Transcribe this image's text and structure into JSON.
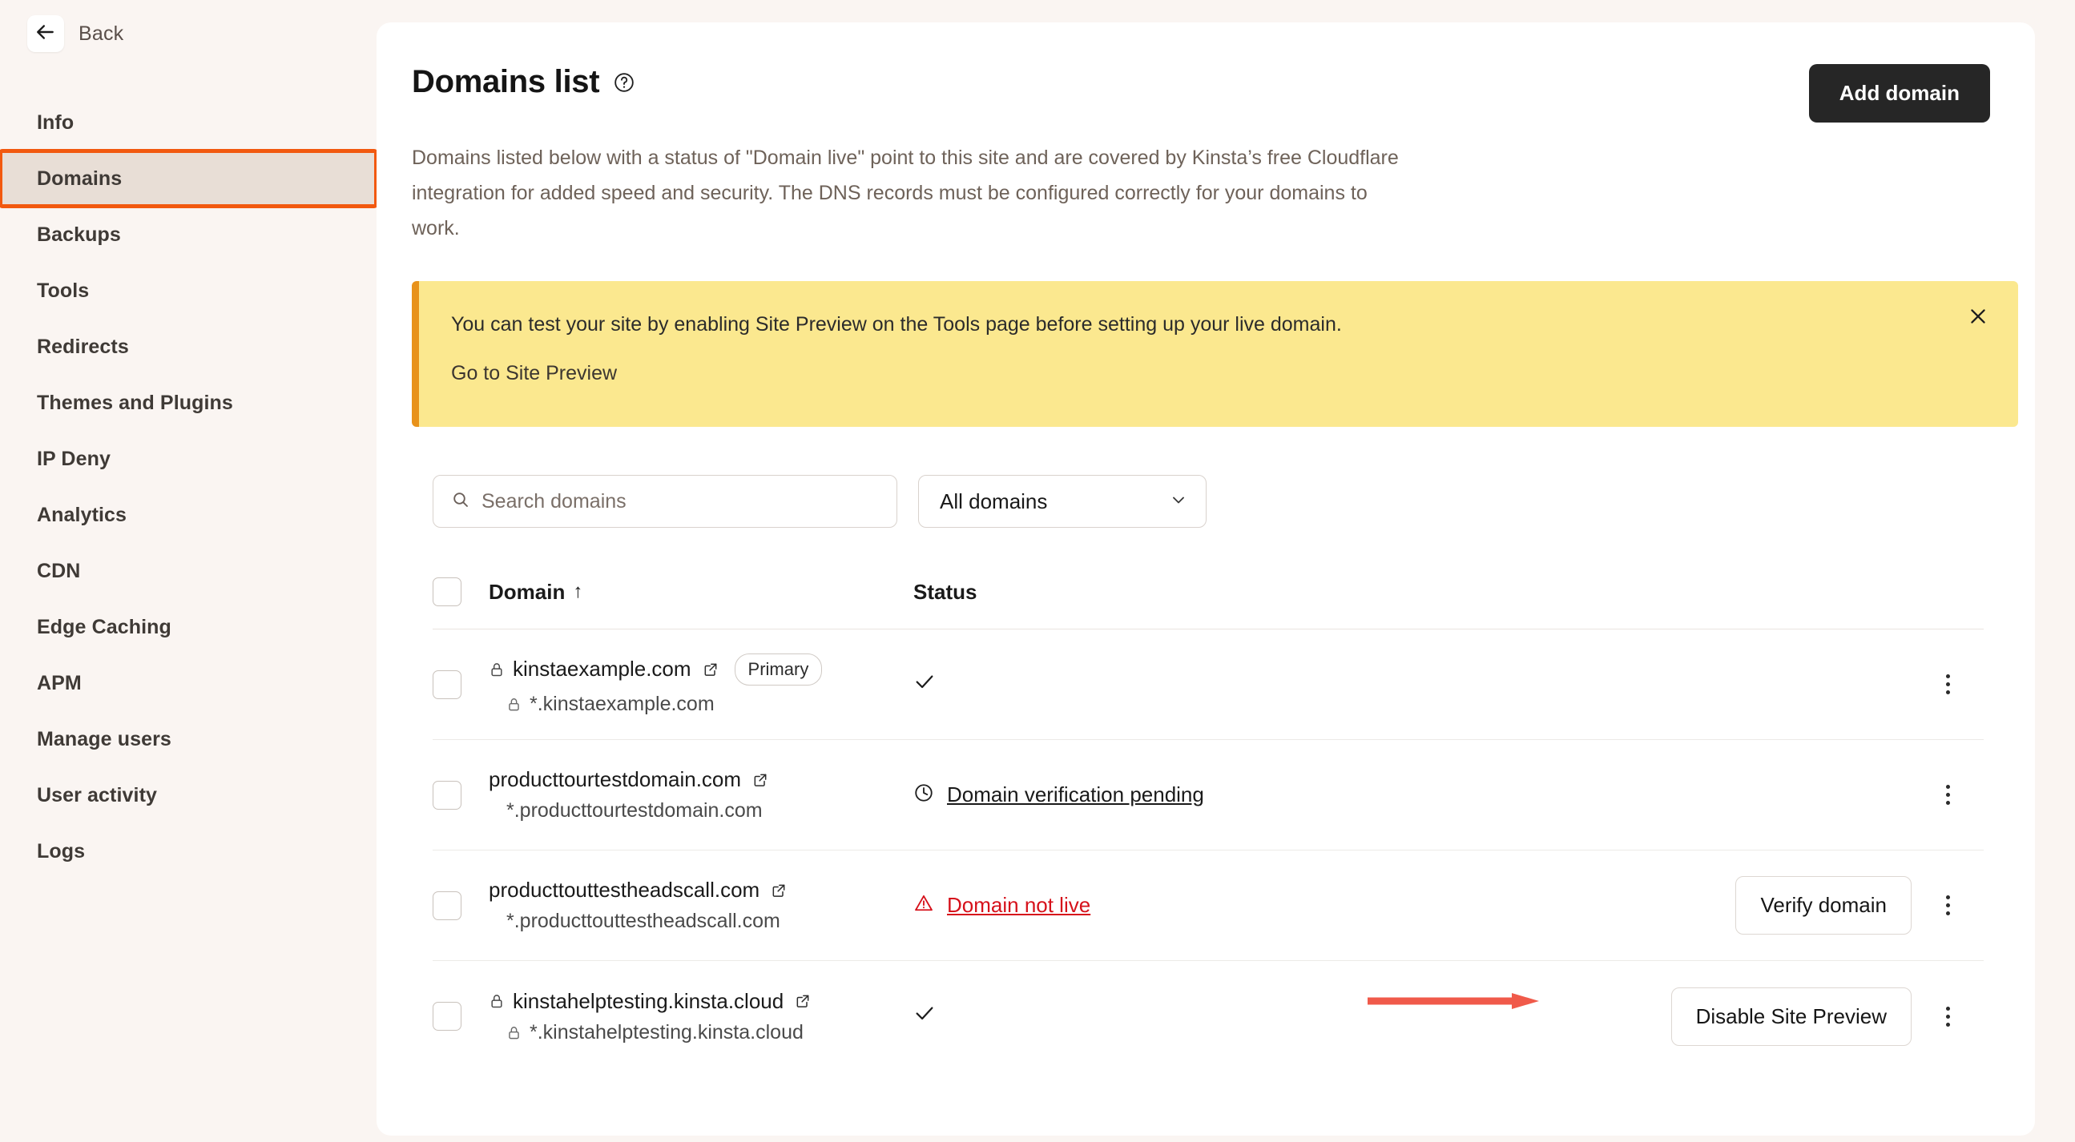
{
  "sidebar": {
    "back_label": "Back",
    "back_icon": "arrow-left-icon",
    "items": [
      {
        "label": "Info",
        "active": false
      },
      {
        "label": "Domains",
        "active": true
      },
      {
        "label": "Backups",
        "active": false
      },
      {
        "label": "Tools",
        "active": false
      },
      {
        "label": "Redirects",
        "active": false
      },
      {
        "label": "Themes and Plugins",
        "active": false
      },
      {
        "label": "IP Deny",
        "active": false
      },
      {
        "label": "Analytics",
        "active": false
      },
      {
        "label": "CDN",
        "active": false
      },
      {
        "label": "Edge Caching",
        "active": false
      },
      {
        "label": "APM",
        "active": false
      },
      {
        "label": "Manage users",
        "active": false
      },
      {
        "label": "User activity",
        "active": false
      },
      {
        "label": "Logs",
        "active": false
      }
    ]
  },
  "header": {
    "title": "Domains list",
    "help_icon": "question-circle-icon",
    "add_domain_label": "Add domain",
    "description": "Domains listed below with a status of \"Domain live\" point to this site and are covered by Kinsta’s free Cloudflare integration for added speed and security. The DNS records must be configured correctly for your domains to work."
  },
  "banner": {
    "message": "You can test your site by enabling Site Preview on the Tools page before setting up your live domain.",
    "link_label": "Go to Site Preview",
    "close_icon": "close-icon",
    "background": "#fbe88f",
    "accent": "#e8921a"
  },
  "filters": {
    "search_placeholder": "Search domains",
    "search_value": "",
    "search_icon": "search-icon",
    "select_value": "All domains",
    "select_icon": "chevron-down-icon"
  },
  "table": {
    "columns": {
      "domain": "Domain",
      "sort_indicator": "↑",
      "status": "Status"
    },
    "rows": [
      {
        "domain": "kinstaexample.com",
        "has_lock": true,
        "badge": "Primary",
        "wildcard": "*.kinstaexample.com",
        "wildcard_has_lock": true,
        "status_type": "live",
        "status_label": "",
        "status_icon": "check-icon",
        "action": "",
        "menu_icon": "kebab-menu-icon"
      },
      {
        "domain": "producttourtestdomain.com",
        "has_lock": false,
        "badge": "",
        "wildcard": "*.producttourtestdomain.com",
        "wildcard_has_lock": false,
        "status_type": "pending",
        "status_label": "Domain verification pending",
        "status_icon": "clock-icon",
        "action": "",
        "menu_icon": "kebab-menu-icon"
      },
      {
        "domain": "producttouttestheadscall.com",
        "has_lock": false,
        "badge": "",
        "wildcard": "*.producttouttestheadscall.com",
        "wildcard_has_lock": false,
        "status_type": "error",
        "status_label": "Domain not live",
        "status_icon": "warning-triangle-icon",
        "action": "Verify domain",
        "menu_icon": "kebab-menu-icon"
      },
      {
        "domain": "kinstahelptesting.kinsta.cloud",
        "has_lock": true,
        "badge": "",
        "wildcard": "*.kinstahelptesting.kinsta.cloud",
        "wildcard_has_lock": true,
        "status_type": "live",
        "status_label": "",
        "status_icon": "check-icon",
        "action": "Disable Site Preview",
        "menu_icon": "kebab-menu-icon"
      }
    ]
  },
  "annotations": {
    "highlight_color": "#f2590f",
    "arrow_color": "#f05a4a",
    "arrow_target": "Disable Site Preview"
  }
}
